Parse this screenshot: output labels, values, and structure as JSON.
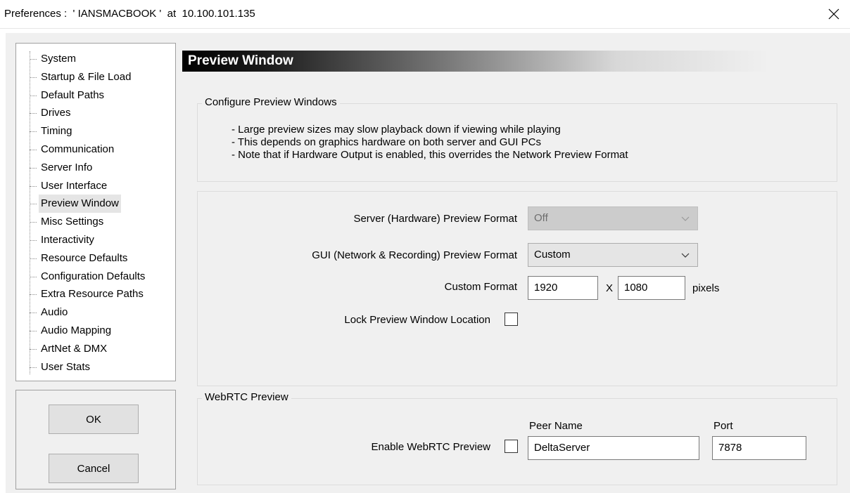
{
  "window": {
    "title": "Preferences :  ' IANSMACBOOK '  at  10.100.101.135",
    "close_icon": "close-icon"
  },
  "tree": {
    "items": [
      {
        "label": "System"
      },
      {
        "label": "Startup & File Load"
      },
      {
        "label": "Default Paths"
      },
      {
        "label": "Drives"
      },
      {
        "label": "Timing"
      },
      {
        "label": "Communication"
      },
      {
        "label": "Server Info"
      },
      {
        "label": "User Interface"
      },
      {
        "label": "Preview Window",
        "selected": true
      },
      {
        "label": "Misc Settings"
      },
      {
        "label": "Interactivity"
      },
      {
        "label": "Resource Defaults"
      },
      {
        "label": "Configuration Defaults"
      },
      {
        "label": "Extra Resource Paths"
      },
      {
        "label": "Audio"
      },
      {
        "label": "Audio Mapping"
      },
      {
        "label": "ArtNet & DMX"
      },
      {
        "label": "User Stats"
      }
    ]
  },
  "buttons": {
    "ok": "OK",
    "cancel": "Cancel"
  },
  "page": {
    "header": "Preview Window",
    "configure_group": {
      "label": "Configure Preview Windows",
      "notes": [
        "- Large preview sizes may slow playback down if viewing while playing",
        "- This depends on graphics hardware on both server and GUI PCs",
        "- Note that if Hardware Output is enabled, this overrides the Network Preview Format"
      ]
    },
    "format_group": {
      "server_label": "Server (Hardware) Preview Format",
      "server_value": "Off",
      "gui_label": "GUI (Network & Recording) Preview Format",
      "gui_value": "Custom",
      "custom_label": "Custom Format",
      "width": "1920",
      "x_sep": "X",
      "height": "1080",
      "unit": "pixels",
      "lock_label": "Lock Preview Window Location",
      "lock_checked": false
    },
    "webrtc_group": {
      "label": "WebRTC Preview",
      "enable_label": "Enable WebRTC Preview",
      "enable_checked": false,
      "peer_label": "Peer Name",
      "peer_value": "DeltaServer",
      "port_label": "Port",
      "port_value": "7878"
    }
  }
}
